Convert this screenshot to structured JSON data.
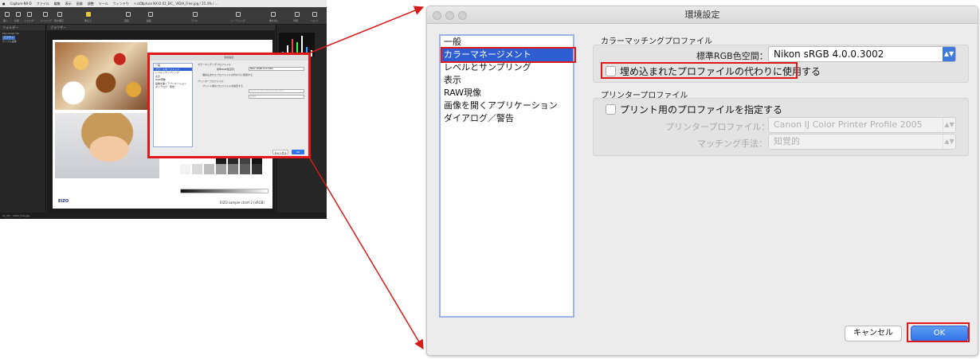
{
  "app": {
    "menu": [
      "Capture NX-D",
      "ファイル",
      "編集",
      "表示",
      "画像",
      "調整",
      "ツール",
      "ウィンドウ",
      "ヘルプ"
    ],
    "window_title": "Capture NX-D   01_EIC_ VIDIA_Free.jpg / 25.4% / ...",
    "toolbar_labels": [
      "開く",
      "比較",
      "フォルダー",
      "トリミング",
      "傾き補正",
      "明るさ",
      "回転",
      "編集",
      "ラベル",
      "レーティング",
      "書き出し",
      "印刷",
      "ヘルプ"
    ],
    "left_panel": {
      "header": "フォルダー",
      "items": [
        "Macintosh HD",
        "ピクチャ",
        "サンプル画像"
      ]
    },
    "viewer_header": "ブラウザー",
    "sheet_caption": "EIZO sample chart 2  (sRGB)",
    "eizo_logo": "EIZO",
    "status": "01_EIC_ VIDIA_Free.jpg"
  },
  "mini_dialog": {
    "title": "環境設定",
    "items": [
      "一般",
      "カラーマネージメント",
      "レベルとサンプリング",
      "表示",
      "RAW現像",
      "画像を開くアプリケーション",
      "ダイアログ／警告"
    ],
    "section1": "カラーマッチングプロファイル",
    "field1_label": "標準RGB色空間：",
    "field1_value": "Nikon sRGB 4.0.0.3002",
    "check1": "埋め込まれたプロファイルの代わりに使用する",
    "section2": "プリンタープロファイル",
    "check2": "プリント用のプロファイルを指定する",
    "field2_value": "Canon IJ Color Printer Profile 2005",
    "field3_value": "知覚的",
    "cancel": "キャンセル",
    "ok": "OK"
  },
  "dialog": {
    "title": "環境設定",
    "categories": [
      {
        "label": "一般",
        "selected": false
      },
      {
        "label": "カラーマネージメント",
        "selected": true
      },
      {
        "label": "レベルとサンプリング",
        "selected": false
      },
      {
        "label": "表示",
        "selected": false
      },
      {
        "label": "RAW現像",
        "selected": false
      },
      {
        "label": "画像を開くアプリケーション",
        "selected": false
      },
      {
        "label": "ダイアログ／警告",
        "selected": false
      }
    ],
    "color_matching": {
      "section_label": "カラーマッチングプロファイル",
      "standard_rgb_label": "標準RGB色空間：",
      "standard_rgb_value": "Nikon sRGB 4.0.0.3002",
      "use_instead_embedded_label": "埋め込まれたプロファイルの代わりに使用する",
      "use_instead_embedded_checked": false
    },
    "printer": {
      "section_label": "プリンタープロファイル",
      "specify_print_profile_label": "プリント用のプロファイルを指定する",
      "specify_print_profile_checked": false,
      "printer_profile_label": "プリンタープロファイル：",
      "printer_profile_value": "Canon IJ Color Printer Profile 2005",
      "matching_method_label": "マッチング手法：",
      "matching_method_value": "知覚的"
    },
    "buttons": {
      "cancel": "キャンセル",
      "ok": "OK"
    }
  },
  "colors": {
    "highlight_red": "#e01818",
    "selection_blue": "#2f5dd2",
    "ok_blue": "#2f73e6"
  }
}
